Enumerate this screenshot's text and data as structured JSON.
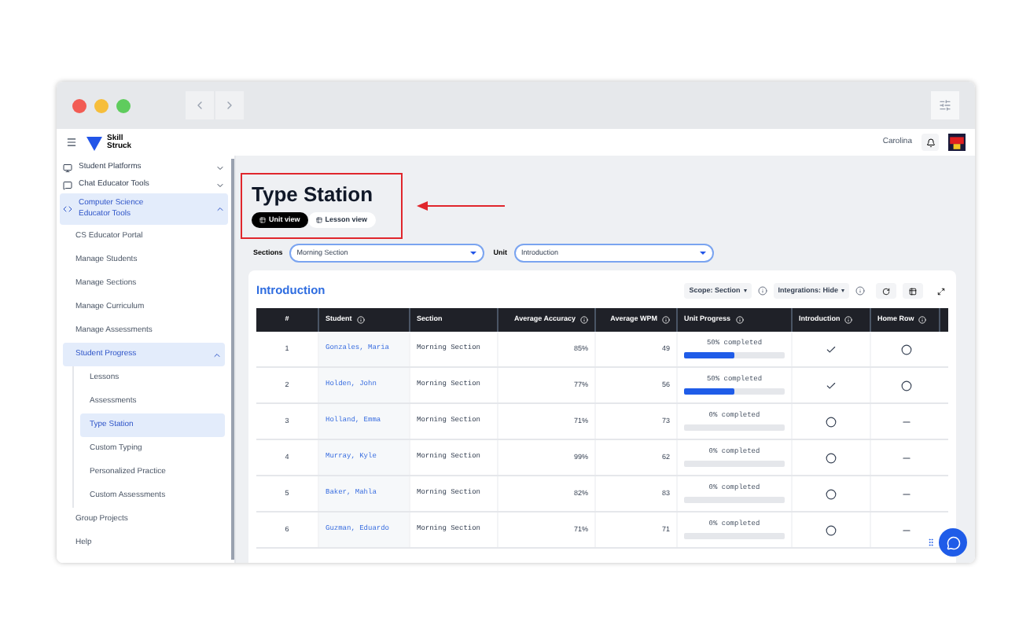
{
  "header": {
    "brand": "Skill\nStruck",
    "user": "Carolina"
  },
  "sidebar": {
    "items": [
      {
        "label": "Student Platforms",
        "expanded": false,
        "selected": false
      },
      {
        "label": "Chat Educator Tools",
        "expanded": false,
        "selected": false
      },
      {
        "label": "Computer Science Educator Tools",
        "expanded": true,
        "selected": true,
        "children": [
          {
            "label": "CS Educator Portal",
            "selected": false
          },
          {
            "label": "Manage Students",
            "selected": false
          },
          {
            "label": "Manage Sections",
            "selected": false
          },
          {
            "label": "Manage Curriculum",
            "selected": false
          },
          {
            "label": "Manage Assessments",
            "selected": false
          },
          {
            "label": "Student Progress",
            "expanded": true,
            "selected": true,
            "children": [
              {
                "label": "Lessons",
                "selected": false
              },
              {
                "label": "Assessments",
                "selected": false
              },
              {
                "label": "Type Station",
                "selected": true
              },
              {
                "label": "Custom Typing",
                "selected": false
              },
              {
                "label": "Personalized Practice",
                "selected": false
              },
              {
                "label": "Custom Assessments",
                "selected": false
              }
            ]
          },
          {
            "label": "Group Projects",
            "selected": false
          },
          {
            "label": "Help",
            "selected": false
          }
        ]
      }
    ]
  },
  "page": {
    "title": "Type Station",
    "views": [
      {
        "label": "Unit view",
        "selected": true
      },
      {
        "label": "Lesson view",
        "selected": false
      }
    ]
  },
  "filters": [
    {
      "label": "Sections",
      "value": "Morning Section"
    },
    {
      "label": "Unit",
      "value": "Introduction"
    }
  ],
  "card": {
    "title": "Introduction",
    "controls": [
      "Scope: Section",
      "Integrations: Hide"
    ]
  },
  "table": {
    "columns": [
      {
        "label": "#",
        "info": false
      },
      {
        "label": "Student",
        "info": true
      },
      {
        "label": "Section",
        "info": false
      },
      {
        "label": "Average Accuracy",
        "info": true
      },
      {
        "label": "Average WPM",
        "info": true
      },
      {
        "label": "Unit Progress",
        "info": true
      },
      {
        "label": "Introduction",
        "info": true
      },
      {
        "label": "Home Row",
        "info": true
      }
    ],
    "rows": [
      {
        "num": "1",
        "student": "Gonzales, Maria",
        "section": "Morning Section",
        "accuracy": "85%",
        "wpm": "49",
        "progress": "50% completed",
        "level": 0.5,
        "lessons": [
          {
            "kind": "check"
          },
          {
            "kind": "circle"
          }
        ]
      },
      {
        "num": "2",
        "student": "Holden, John",
        "section": "Morning Section",
        "accuracy": "77%",
        "wpm": "56",
        "progress": "50% completed",
        "level": 0.5,
        "lessons": [
          {
            "kind": "check"
          },
          {
            "kind": "circle"
          }
        ]
      },
      {
        "num": "3",
        "student": "Holland, Emma",
        "section": "Morning Section",
        "accuracy": "71%",
        "wpm": "73",
        "progress": "0% completed",
        "level": 0,
        "lessons": [
          {
            "kind": "circle"
          },
          {
            "kind": "dash"
          }
        ]
      },
      {
        "num": "4",
        "student": "Murray, Kyle",
        "section": "Morning Section",
        "accuracy": "99%",
        "wpm": "62",
        "progress": "0% completed",
        "level": 0,
        "lessons": [
          {
            "kind": "circle"
          },
          {
            "kind": "dash"
          }
        ]
      },
      {
        "num": "5",
        "student": "Baker, Mahla",
        "section": "Morning Section",
        "accuracy": "82%",
        "wpm": "83",
        "progress": "0% completed",
        "level": 0,
        "lessons": [
          {
            "kind": "circle"
          },
          {
            "kind": "dash"
          }
        ]
      },
      {
        "num": "6",
        "student": "Guzman, Eduardo",
        "section": "Morning Section",
        "accuracy": "71%",
        "wpm": "71",
        "progress": "0% completed",
        "level": 0,
        "lessons": [
          {
            "kind": "circle"
          },
          {
            "kind": "dash"
          }
        ]
      }
    ]
  }
}
